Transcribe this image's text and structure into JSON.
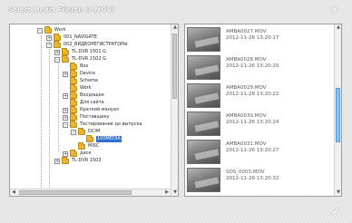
{
  "dialog": {
    "title": "Select Media File(s): (*.MOV)",
    "close_glyph": "✕",
    "ok_glyph": "✔"
  },
  "tree": {
    "rows": [
      {
        "label": "Work",
        "exp": "–"
      },
      {
        "label": "001_NAVIGATE",
        "exp": "+"
      },
      {
        "label": "002_ВИДЕОРЕГИСТРАТОРЫ",
        "exp": "–"
      },
      {
        "label": "TL-DVR 1501 G",
        "exp": "+"
      },
      {
        "label": "TL-DVR 1502 G",
        "exp": "–"
      },
      {
        "label": "Box",
        "exp": ""
      },
      {
        "label": "Device",
        "exp": "+"
      },
      {
        "label": "Scheme",
        "exp": ""
      },
      {
        "label": "Work",
        "exp": ""
      },
      {
        "label": "Входящее",
        "exp": "+"
      },
      {
        "label": "Для сайта",
        "exp": ""
      },
      {
        "label": "Краткий мануал",
        "exp": "+"
      },
      {
        "label": "Поставщику",
        "exp": "+"
      },
      {
        "label": "Тестирование до выпуска",
        "exp": "–"
      },
      {
        "label": "DCIM",
        "exp": "–"
      },
      {
        "label": "100MEDIA",
        "exp": ""
      },
      {
        "label": "MISC",
        "exp": ""
      },
      {
        "label": "диск",
        "exp": "+"
      },
      {
        "label": "TL-DVR 1503",
        "exp": "+"
      }
    ]
  },
  "files": [
    {
      "name": "AMBA0027.MOV",
      "date": "2012-11-26  13:20:17"
    },
    {
      "name": "AMBA0028.MOV",
      "date": "2012-11-26  13:20:20"
    },
    {
      "name": "AMBA0029.MOV",
      "date": "2012-11-26  13:20:22"
    },
    {
      "name": "AMBA0030.MOV",
      "date": "2012-11-26  13:20:24"
    },
    {
      "name": "AMBA0031.MOV",
      "date": "2012-11-26  13:20:27"
    },
    {
      "name": "SOS_0003.MOV",
      "date": "2012-11-26  13:20:32"
    }
  ],
  "scroll": {
    "up": "▲",
    "down": "▼",
    "left": "◀",
    "right": "▶"
  }
}
